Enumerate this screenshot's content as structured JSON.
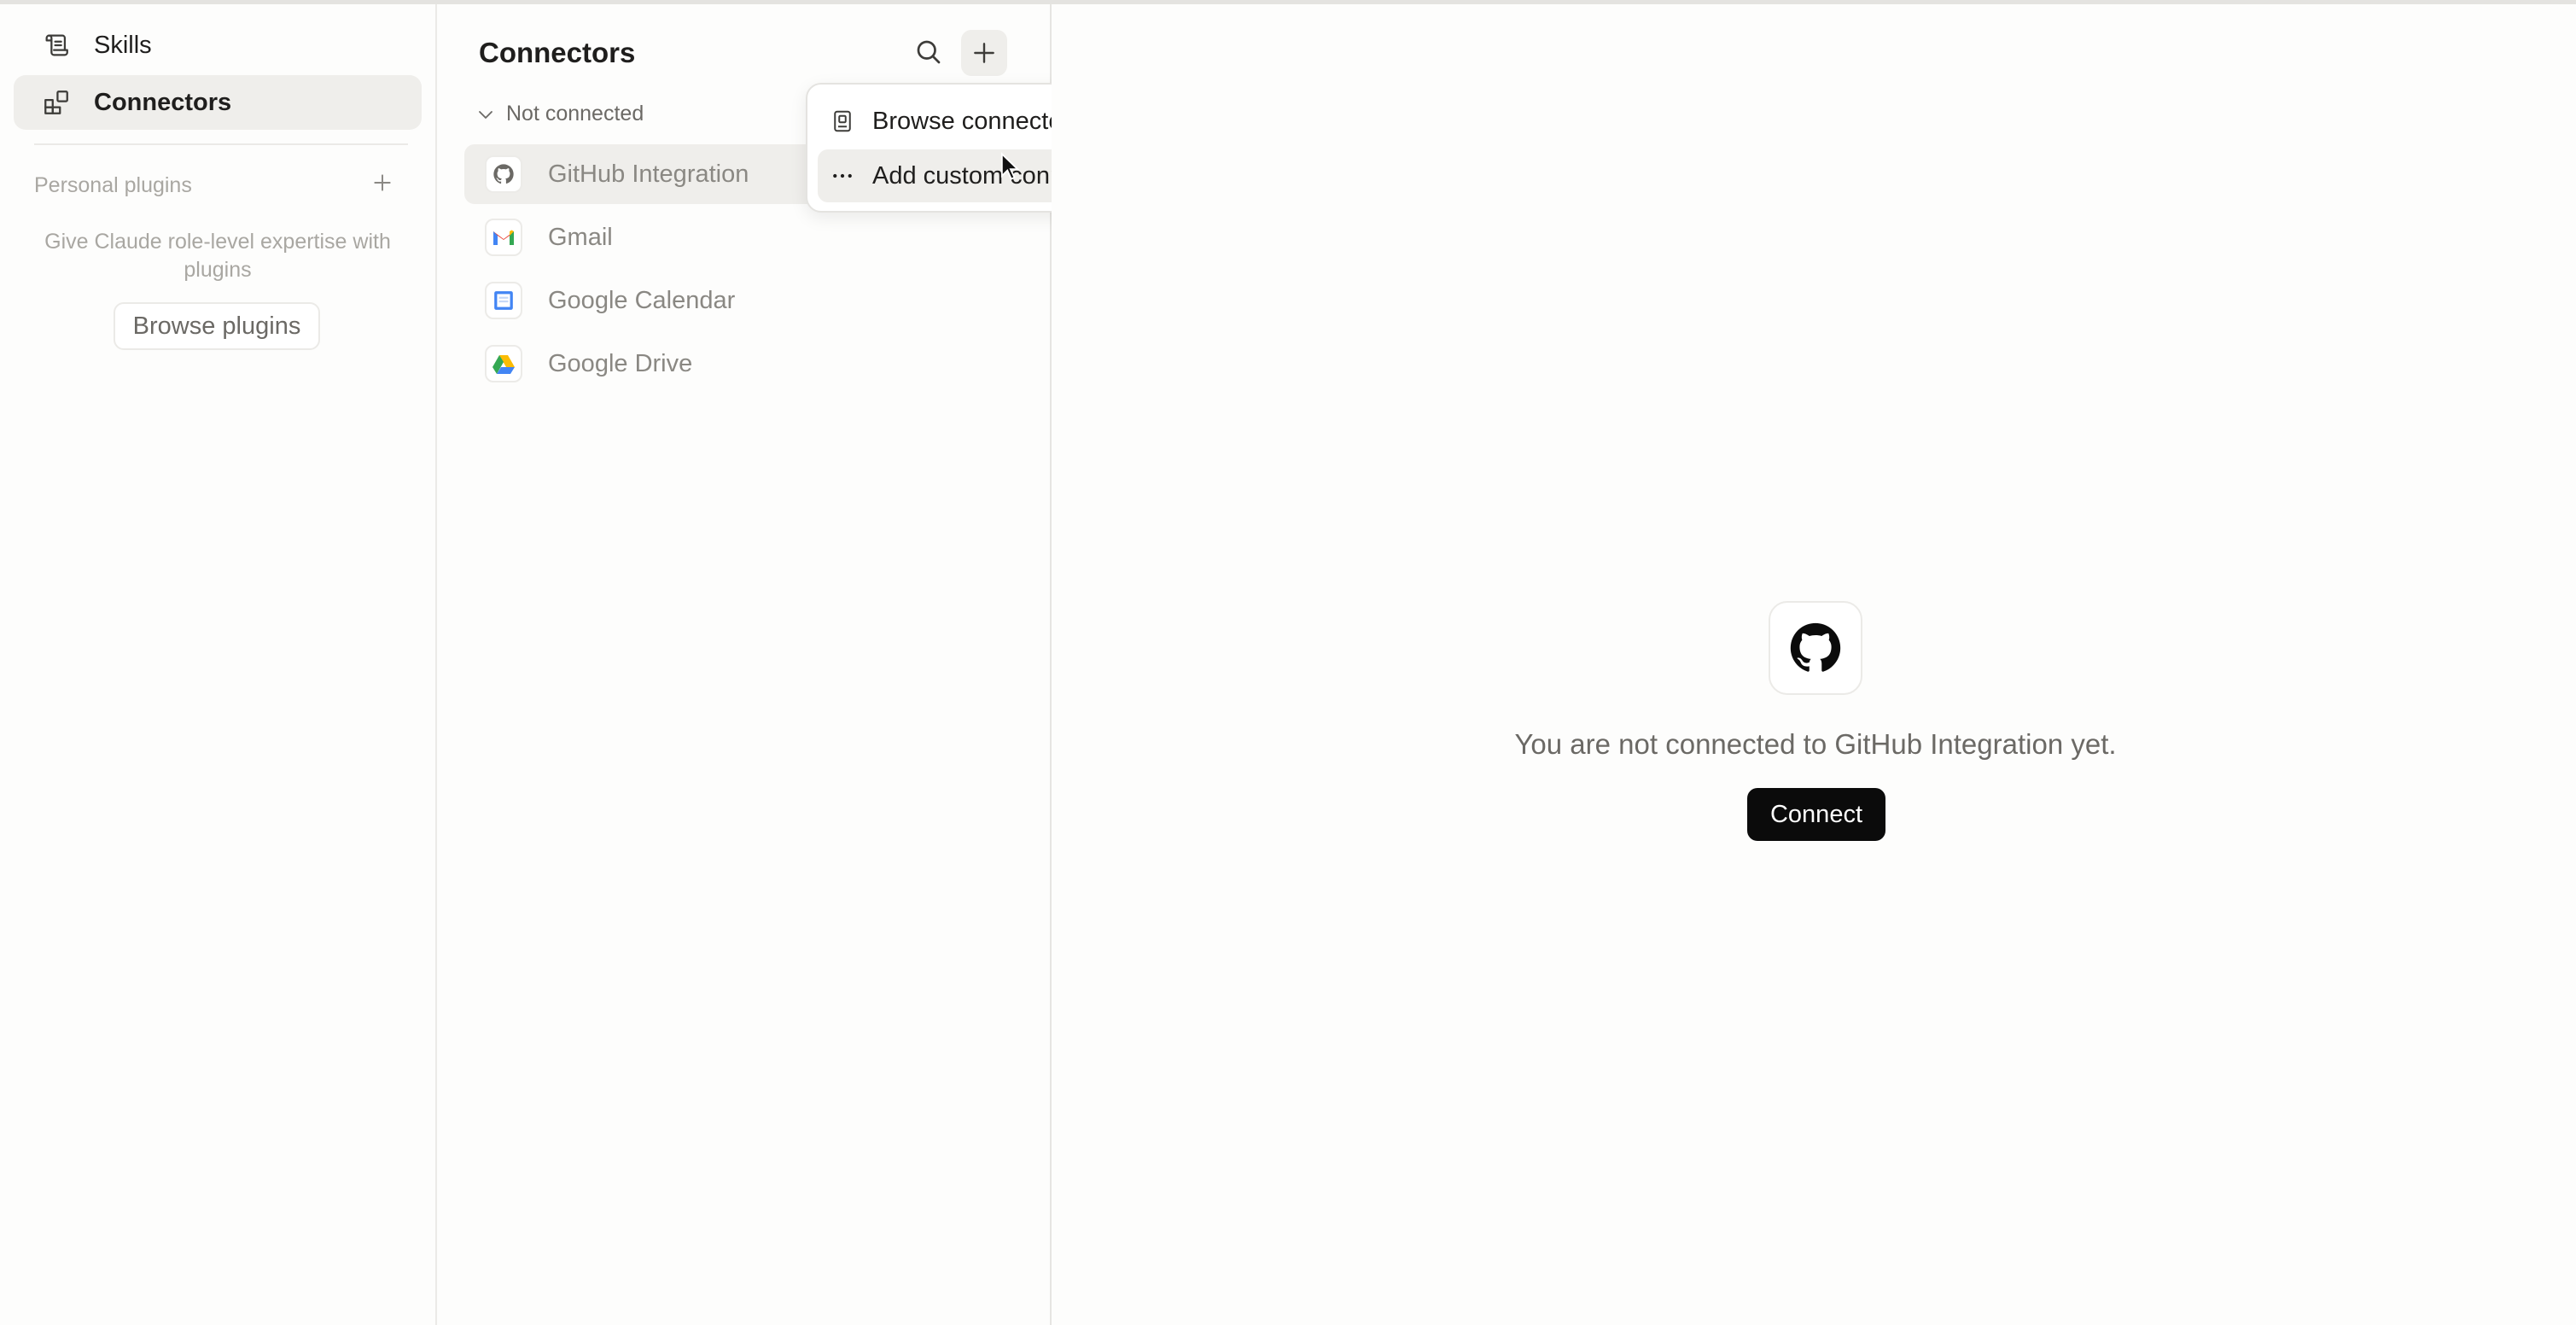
{
  "sidebar": {
    "items": [
      {
        "label": "Skills",
        "icon": "scroll-icon",
        "active": false
      },
      {
        "label": "Connectors",
        "icon": "connectors-icon",
        "active": true
      }
    ],
    "personal_plugins": {
      "label": "Personal plugins",
      "empty_text": "Give Claude role-level expertise with plugins",
      "browse_label": "Browse plugins"
    }
  },
  "connectors": {
    "title": "Connectors",
    "group_label": "Not connected",
    "items": [
      {
        "label": "GitHub Integration",
        "icon": "github-icon",
        "selected": true
      },
      {
        "label": "Gmail",
        "icon": "gmail-icon",
        "selected": false
      },
      {
        "label": "Google Calendar",
        "icon": "google-calendar-icon",
        "selected": false
      },
      {
        "label": "Google Drive",
        "icon": "google-drive-icon",
        "selected": false
      }
    ]
  },
  "menu": {
    "items": [
      {
        "label": "Browse connectors",
        "icon": "book-icon"
      },
      {
        "label": "Add custom connector",
        "icon": "more-horizontal-icon"
      }
    ]
  },
  "detail": {
    "message": "You are not connected to GitHub Integration yet.",
    "connect_label": "Connect",
    "icon": "github-icon"
  },
  "colors": {
    "active_bg": "#efeeeb",
    "connect_bg": "#0b0b0b",
    "muted_text": "#a9a7a2"
  }
}
